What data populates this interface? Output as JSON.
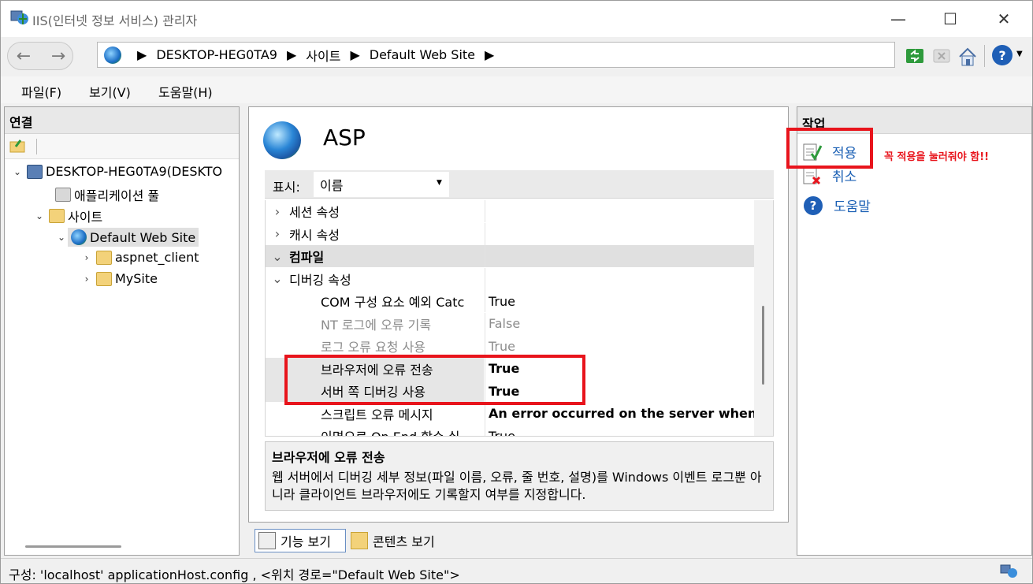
{
  "window": {
    "title": "IIS(인터넷 정보 서비스) 관리자",
    "controls": {
      "minimize": "—",
      "maximize": "☐",
      "close": "✕"
    }
  },
  "address": {
    "crumbs": [
      "DESKTOP-HEG0TA9",
      "사이트",
      "Default Web Site"
    ],
    "back": "←",
    "forward": "→",
    "help": "?"
  },
  "menu": [
    "파일(F)",
    "보기(V)",
    "도움말(H)"
  ],
  "connections": {
    "header": "연결",
    "tree": {
      "server": "DESKTOP-HEG0TA9(DESKTO",
      "app_pools": "애플리케이션 풀",
      "sites": "사이트",
      "default_site": "Default Web Site",
      "aspnet_client": "aspnet_client",
      "mysite": "MySite"
    }
  },
  "feature": {
    "title": "ASP",
    "display_label": "표시:",
    "display_value": "이름",
    "rows": [
      {
        "type": "group",
        "expanded": false,
        "name": "세션 속성",
        "value": ""
      },
      {
        "type": "group",
        "expanded": false,
        "name": "캐시 속성",
        "value": ""
      },
      {
        "type": "group",
        "expanded": true,
        "name": "컴파일",
        "value": "",
        "selected": true
      },
      {
        "type": "group",
        "expanded": true,
        "name": "디버깅 속성",
        "value": ""
      },
      {
        "type": "prop",
        "name": "COM 구성 요소 예외 Catc",
        "value": "True",
        "style": "normal"
      },
      {
        "type": "prop",
        "name": "NT 로그에 오류 기록",
        "value": "False",
        "style": "gray"
      },
      {
        "type": "prop",
        "name": "로그 오류 요청 사용",
        "value": "True",
        "style": "gray"
      },
      {
        "type": "prop",
        "name": "브라우저에 오류 전송",
        "value": "True",
        "style": "bold",
        "highlight": true
      },
      {
        "type": "prop",
        "name": "서버 쪽 디버깅 사용",
        "value": "True",
        "style": "bold",
        "highlight": true
      },
      {
        "type": "prop",
        "name": "스크립트 오류 메시지",
        "value": "An error occurred on the server when p",
        "style": "bold"
      },
      {
        "type": "prop",
        "name": "이면으로 On End 함수 실",
        "value": "True",
        "style": "normal"
      }
    ],
    "desc_title": "브라우저에 오류 전송",
    "desc_text": "웹 서버에서 디버깅 세부 정보(파일 이름, 오류, 줄 번호, 설명)를 Windows 이벤트 로그뿐 아니라 클라이언트 브라우저에도 기록할지 여부를 지정합니다.",
    "view_features": "기능 보기",
    "view_content": "콘텐츠 보기"
  },
  "actions": {
    "header": "작업",
    "apply": "적용",
    "cancel": "취소",
    "help": "도움말",
    "note": "꼭 적용을 눌러줘야 함!!"
  },
  "status": "구성: 'localhost' applicationHost.config , <위치 경로=\"Default Web Site\">",
  "colors": {
    "accent_link": "#1a5fb4",
    "annotation_red": "#e8141c",
    "selected_row": "#e0e0e0"
  }
}
